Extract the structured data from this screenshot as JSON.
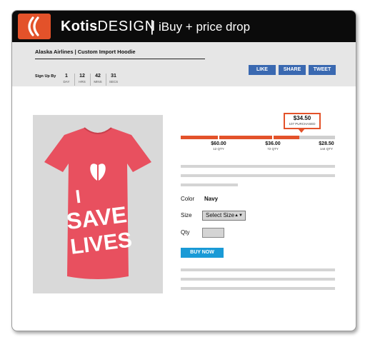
{
  "header": {
    "brand_bold": "Kotis",
    "brand_light": "DESIGN",
    "separator": "|",
    "app_title": "iBuy + price drop",
    "logo_icon": "kotis-logo-icon",
    "accent_color": "#e3522a"
  },
  "toolbar": {
    "product_name": "Alaska Airlines | Custom Import Hoodie",
    "signup_label": "Sign Up By",
    "countdown": [
      {
        "value": "1",
        "unit": "DAY"
      },
      {
        "value": "12",
        "unit": "HRS"
      },
      {
        "value": "42",
        "unit": "MINS"
      },
      {
        "value": "31",
        "unit": "SECS"
      }
    ],
    "like_label": "LIKE",
    "share_label": "SHARE",
    "tweet_label": "TWEET",
    "social_color": "#3a69b1"
  },
  "product": {
    "image": {
      "icon": "tshirt-image",
      "shirt_color": "#e8505f",
      "shirt_text": [
        "I",
        "SAVE",
        "LIVES"
      ]
    },
    "price_tiers": {
      "current_price": "$34.50",
      "purchased": "107 PURCHASED",
      "progress": 0.77,
      "tiers": [
        {
          "price": "$60.00",
          "qty": "12 QTY"
        },
        {
          "price": "$36.00",
          "qty": "72 QTY"
        },
        {
          "price": "$28.50",
          "qty": "144 QTY"
        }
      ]
    },
    "color_label": "Color",
    "color_value": "Navy",
    "size_label": "Size",
    "size_selected": "Select Size",
    "size_arrows": "▲▼",
    "qty_label": "Qty",
    "qty_value": "",
    "buy_label": "BUY NOW",
    "buy_color": "#1a9ad6"
  }
}
